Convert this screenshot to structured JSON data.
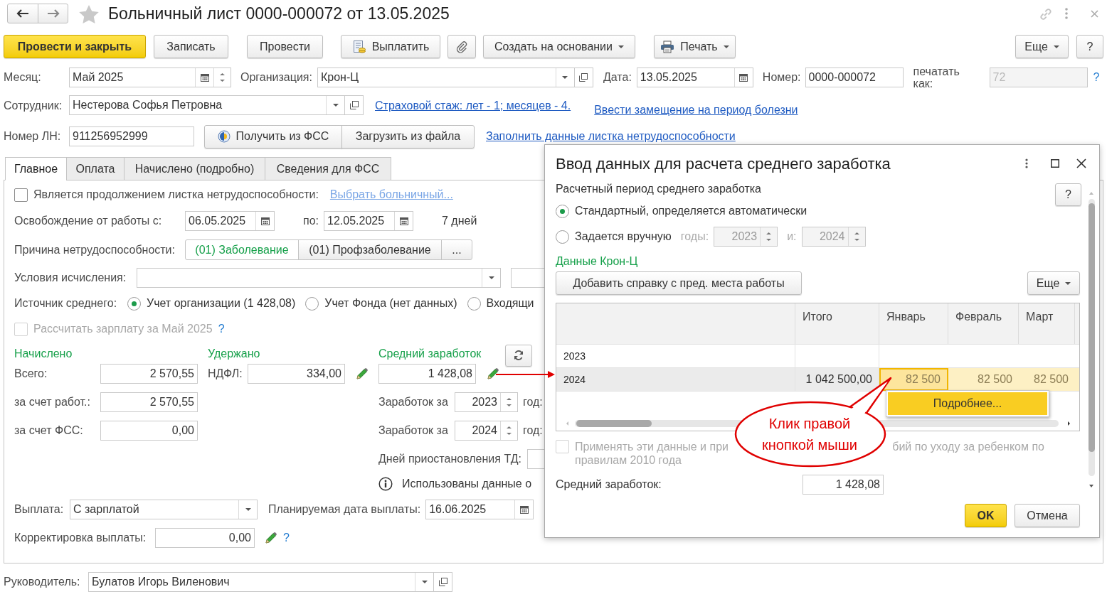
{
  "window": {
    "title": "Больничный лист 0000-000072 от 13.05.2025",
    "favorite": false
  },
  "toolbar": [
    {
      "label": "Провести и закрыть",
      "kind": "primary"
    },
    {
      "label": "Записать",
      "kind": "plain"
    },
    {
      "label": "Провести",
      "kind": "plain"
    },
    {
      "label": "Выплатить",
      "kind": "pay"
    },
    {
      "kind": "attach"
    },
    {
      "label": "Создать на основании",
      "kind": "menu"
    },
    {
      "label": "Печать",
      "kind": "print"
    },
    {
      "label": "Еще",
      "kind": "menu"
    },
    {
      "label": "?",
      "kind": "help"
    }
  ],
  "month": {
    "label": "Месяц:",
    "value": "Май 2025"
  },
  "organization": {
    "label": "Организация:",
    "value": "Крон-Ц"
  },
  "date": {
    "label": "Дата:",
    "value": "13.05.2025"
  },
  "number": {
    "label": "Номер:",
    "value": "0000-000072"
  },
  "print_as": {
    "label": "печатать как:",
    "placeholder": "72",
    "help": "?"
  },
  "employee": {
    "label": "Сотрудник:",
    "value": "Нестерова Софья Петровна"
  },
  "insurance_link": "Страховой стаж: лет - 1; месяцев - 4.",
  "substitution_link": "Ввести замещение на период болезни",
  "sick_note_number": {
    "label": "Номер ЛН:",
    "value": "911256952999"
  },
  "fss_buttons": [
    "Получить из ФСС",
    "Загрузить из файла"
  ],
  "fill_link": "Заполнить данные листка нетрудоспособности",
  "tabs": [
    {
      "label": "Главное",
      "selected": true
    },
    {
      "label": "Оплата",
      "selected": false
    },
    {
      "label": "Начислено (подробно)",
      "selected": false
    },
    {
      "label": "Сведения для ФСС",
      "selected": false
    }
  ],
  "main_tab": {
    "continuation": {
      "label": "Является продолжением листка нетрудоспособности:",
      "checked": false,
      "link": "Выбрать больничный..."
    },
    "release": {
      "label": "Освобождение от работы с:",
      "from": "06.05.2025",
      "to_label": "по:",
      "to": "12.05.2025",
      "days": "7 дней"
    },
    "reason": {
      "label": "Причина нетрудоспособности:",
      "options": [
        {
          "label": "(01) Заболевание",
          "selected": true
        },
        {
          "label": "(01) Профзаболевание",
          "selected": false
        }
      ],
      "more": "..."
    },
    "conditions": {
      "label": "Условия исчисления:"
    },
    "average_source": {
      "label": "Источник среднего:",
      "options": [
        {
          "label": "Учет организации (1 428,08)",
          "selected": true
        },
        {
          "label": "Учет Фонда (нет данных)",
          "selected": false
        },
        {
          "label": "Входящи",
          "selected": false
        }
      ]
    },
    "recalc": {
      "label": "Рассчитать зарплату за Май 2025",
      "checked": false,
      "disabled": true,
      "help": "?"
    },
    "accrued": {
      "title": "Начислено",
      "rows": [
        {
          "label": "Всего:",
          "value": "2 570,55"
        },
        {
          "label": "за счет работ.:",
          "value": "2 570,55"
        },
        {
          "label": "за счет ФСС:",
          "value": "0,00"
        }
      ]
    },
    "withheld": {
      "title": "Удержано",
      "label": "НДФЛ:",
      "value": "334,00"
    },
    "average": {
      "title": "Средний заработок",
      "value": "1 428,08",
      "years": [
        {
          "label": "Заработок за",
          "year": "2023",
          "suffix": "год:"
        },
        {
          "label": "Заработок за",
          "year": "2024",
          "suffix": "год:"
        }
      ],
      "suspension_label": "Дней приостановления ТД:",
      "info": "Использованы данные о"
    },
    "payment": {
      "label": "Выплата:",
      "value": "С зарплатой",
      "date_label": "Планируемая дата выплаты:",
      "date": "16.06.2025"
    },
    "correction": {
      "label": "Корректировка выплаты:",
      "value": "0,00",
      "help": "?"
    }
  },
  "manager": {
    "label": "Руководитель:",
    "value": "Булатов Игорь Виленович"
  },
  "dialog": {
    "title": "Ввод данных для расчета среднего заработка",
    "help": "?",
    "period_label": "Расчетный период среднего заработка",
    "period_options": [
      {
        "label": "Стандартный, определяется автоматически",
        "selected": true
      },
      {
        "label": "Задается вручную",
        "selected": false
      }
    ],
    "years_label": "годы:",
    "year_from": "2023",
    "and_label": "и:",
    "year_to": "2024",
    "section": "Данные Крон-Ц",
    "add_button": "Добавить справку с пред. места работы",
    "more_button": "Еще",
    "table": {
      "columns": [
        "Итого",
        "Январь",
        "Февраль",
        "Март"
      ],
      "rows": [
        {
          "label": "2023",
          "selected": false
        },
        {
          "label": "2024",
          "selected": true,
          "total": "1 042 500,00",
          "months": [
            {
              "value": "82 500",
              "focused": true
            },
            {
              "value": "82 500",
              "focused": false
            },
            {
              "value": "82 500",
              "focused": false
            }
          ]
        }
      ]
    },
    "apply": {
      "checked": false,
      "disabled": true,
      "text_start": "Применять эти данные и при",
      "text_end": "бий по уходу за ребенком по",
      "text_line2": "правилам 2010 года"
    },
    "average_label": "Средний заработок:",
    "average_value": "1 428,08",
    "buttons": [
      {
        "label": "OK",
        "kind": "primary"
      },
      {
        "label": "Отмена",
        "kind": "plain"
      }
    ]
  },
  "context_menu": {
    "items": [
      "Подробнее..."
    ]
  },
  "callout": {
    "text": "Клик правой кнопкой мыши"
  }
}
